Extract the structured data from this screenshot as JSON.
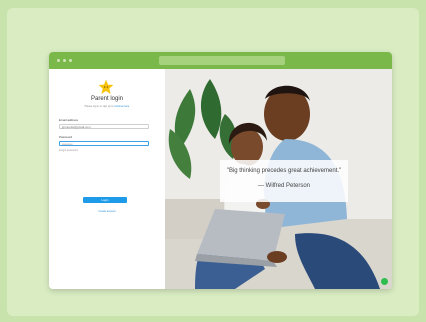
{
  "window": {
    "url": ""
  },
  "login": {
    "title": "Parent login",
    "subtitle_prefix": "Please log in or sign up to",
    "subtitle_link": "continue here",
    "email_label": "Email address",
    "email_value": "jjpmpotts@gmail.com",
    "password_label": "Password",
    "password_value": "••••••••••",
    "forgot_label": "Forgot password",
    "login_button": "Login",
    "register_link": "Create account"
  },
  "quote": {
    "text": "\"Big thinking precedes great achievement.\"",
    "author": "— Wilfred Peterson"
  },
  "colors": {
    "titlebar": "#7bb84a",
    "button": "#1e9be8",
    "chat": "#2ebd4f"
  },
  "icons": {
    "star": "star-mascot-icon",
    "chat": "chat-icon"
  }
}
